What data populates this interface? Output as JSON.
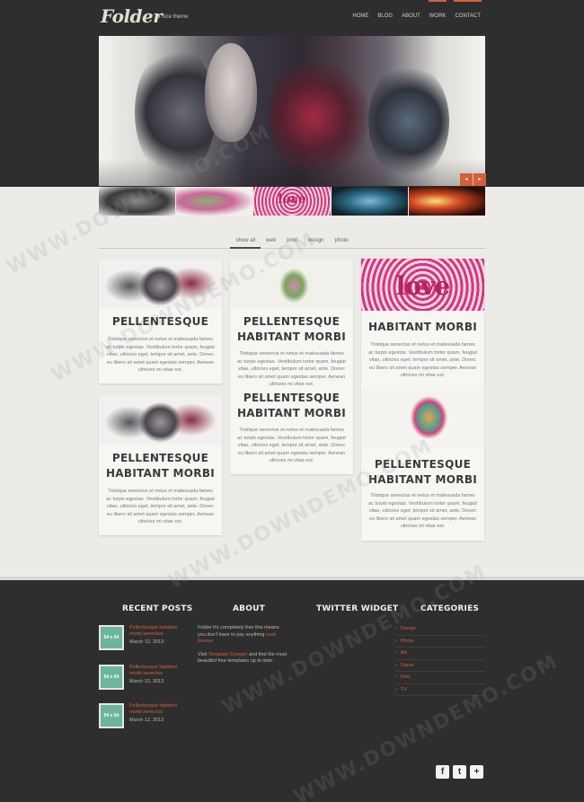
{
  "header": {
    "logo": "Folder",
    "tagline": "a nice theme",
    "nav": [
      "HOME",
      "BLOG",
      "ABOUT",
      "WORK",
      "CONTACT"
    ]
  },
  "slider": {
    "prev_icon": "chevron-left-icon",
    "next_icon": "chevron-right-icon",
    "thumb_label": "love"
  },
  "filters": [
    "show all",
    "web",
    "print",
    "design",
    "photo"
  ],
  "portfolio": {
    "card_text": "Tristique senectus et netus et malesuada fames ac turpis egestas. Vestibulum tortor quam, feugiat vitae, ultricies eget, tempor sit amet, ante. Donec eu libero sit amet quam egestas semper. Aenean ultricies mi vitae est.",
    "image_label": "love",
    "cards": [
      {
        "title": "PELLENTESQUE"
      },
      {
        "title": "PELLENTESQUE HABITANT MORBI"
      },
      {
        "title": "HABITANT MORBI"
      },
      {
        "title": "PELLENTESQUE HABITANT MORBI"
      },
      {
        "title": "PELLENTESQUE HABITANT MORBI"
      },
      {
        "title": "PELLENTESQUE HABITANT MORBI"
      }
    ]
  },
  "footer": {
    "recent_posts": {
      "title": "RECENT POSTS",
      "items": [
        {
          "date_box": "54 x 54",
          "title": "Pellentesque habitant morbi senectus",
          "date": "March 12, 2013"
        },
        {
          "date_box": "54 x 54",
          "title": "Pellentesque habitant morbi senectus",
          "date": "March 12, 2013"
        },
        {
          "date_box": "54 x 54",
          "title": "Pellentesque habitant morbi senectus",
          "date": "March 12, 2013"
        }
      ]
    },
    "about": {
      "title": "ABOUT",
      "p1": "Folder it's completely free this means you don't have to pay anything",
      "p1_link": "read license",
      "p2_pre": "Visit",
      "p2_link": "Template Creeper",
      "p2_post": "and find the most beautiful free templates up to date."
    },
    "twitter": {
      "title": "TWITTER WIDGET"
    },
    "categories": {
      "title": "CATEGORIES",
      "items": [
        "Design",
        "Photo",
        "Art",
        "Game",
        "Film",
        "TV"
      ]
    },
    "social": [
      "f",
      "t",
      "+"
    ]
  },
  "watermark": "WWW.DOWNDEMO.COM",
  "colors": {
    "accent": "#d4603a",
    "dark": "#2e2e2e",
    "page": "#ecebe7",
    "post_thumb": "#6bb59d"
  }
}
